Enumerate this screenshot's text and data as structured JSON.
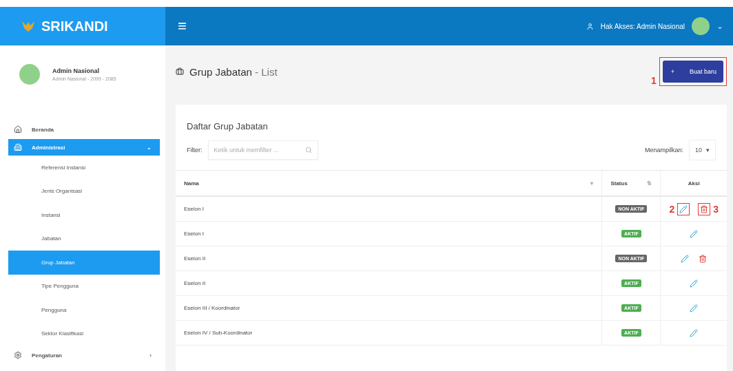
{
  "brand": {
    "name": "SRIKANDI"
  },
  "topbar": {
    "menu_icon": "≡",
    "access": "Hak Akses: Admin Nasional",
    "caret": "⌄"
  },
  "profile": {
    "name": "Admin Nasional",
    "subtitle": "Admin Nasional - 2099 - 2085"
  },
  "sidebar": {
    "items": [
      {
        "label": "Beranda",
        "selected": false
      },
      {
        "label": "Administrasi",
        "selected": true,
        "expanded": true,
        "caret": "⌄",
        "children": [
          {
            "label": "Referensi Instansi",
            "selected": false
          },
          {
            "label": "Jenis Organisasi",
            "selected": false
          },
          {
            "label": "Instansi",
            "selected": false
          },
          {
            "label": "Jabatan",
            "selected": false
          },
          {
            "label": "Grup Jabatan",
            "selected": true
          },
          {
            "label": "Tipe Pengguna",
            "selected": false
          },
          {
            "label": "Pengguna",
            "selected": false
          },
          {
            "label": "Sektor Klasifikasi",
            "selected": false
          }
        ]
      },
      {
        "label": "Pengaturan",
        "selected": false,
        "caret": "›"
      }
    ]
  },
  "page": {
    "title": "Grup Jabatan",
    "suffix": " - List",
    "new_button": {
      "icon": "+",
      "label": "Buat baru",
      "marker": "1"
    }
  },
  "card": {
    "title": "Daftar Grup Jabatan",
    "filter_label": "Filter:",
    "filter_placeholder": "Ketik untuk memfilter ...",
    "show_label": "Menampilkan:",
    "page_size": "10",
    "page_size_caret": "▾"
  },
  "table": {
    "columns": [
      {
        "label": "Nama",
        "sort": "▾"
      },
      {
        "label": "Status",
        "sort": "⇅"
      },
      {
        "label": "Aksi"
      }
    ],
    "rows": [
      {
        "name": "Eselon I",
        "status": "NON AKTIF",
        "active": false,
        "deletable": true,
        "edit_marker": "2",
        "delete_marker": "3"
      },
      {
        "name": "Eselon I",
        "status": "AKTIF",
        "active": true,
        "deletable": false
      },
      {
        "name": "Eselon II",
        "status": "NON AKTIF",
        "active": false,
        "deletable": true
      },
      {
        "name": "Eselon II",
        "status": "AKTIF",
        "active": true,
        "deletable": false
      },
      {
        "name": "Eselon III / Koordinator",
        "status": "AKTIF",
        "active": true,
        "deletable": false
      },
      {
        "name": "Eselon IV / Sub-Koordinator",
        "status": "AKTIF",
        "active": true,
        "deletable": false
      }
    ]
  }
}
